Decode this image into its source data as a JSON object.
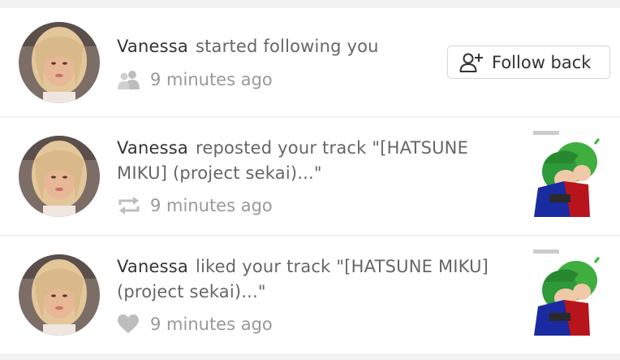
{
  "notifications": [
    {
      "type": "follow",
      "username": "Vanessa",
      "action": "started following you",
      "time": "9 minutes ago",
      "icon": "users-icon",
      "button_label": "Follow back",
      "button_icon": "add-user-icon"
    },
    {
      "type": "repost",
      "username": "Vanessa",
      "action": "reposted your track \"[HATSUNE MIKU] (project sekai)...\"",
      "time": "9 minutes ago",
      "icon": "repost-icon",
      "artwork": "track-artwork"
    },
    {
      "type": "like",
      "username": "Vanessa",
      "action": "liked your track \"[HATSUNE MIKU] (project sekai)...\"",
      "time": "9 minutes ago",
      "icon": "heart-icon",
      "artwork": "track-artwork"
    }
  ],
  "colors": {
    "background": "#f2f2f2",
    "row_background": "#ffffff",
    "username": "#333333",
    "action_text": "#666666",
    "meta_text": "#999999",
    "button_border": "#d6d6d6"
  }
}
